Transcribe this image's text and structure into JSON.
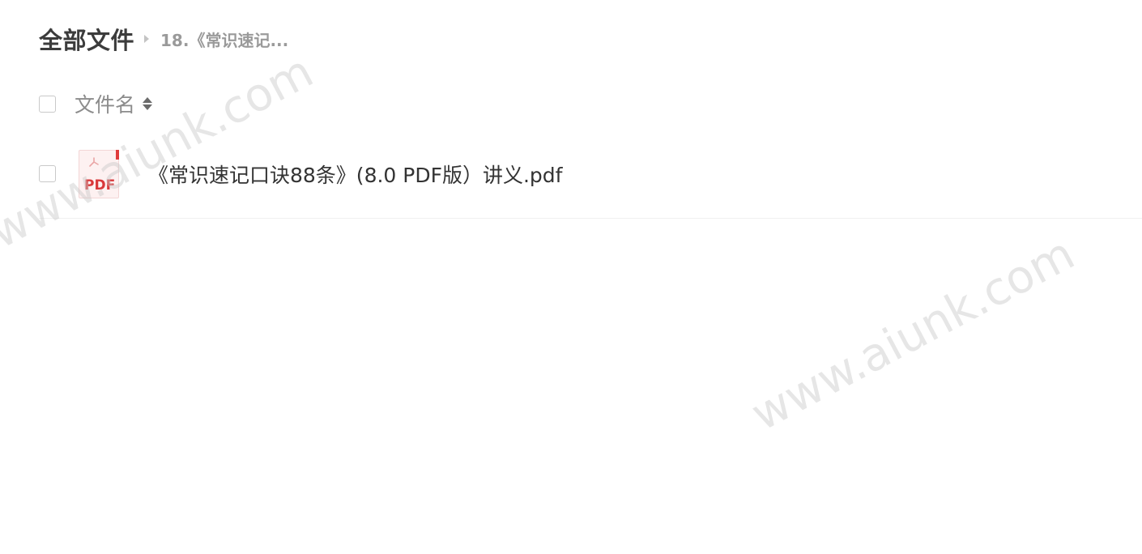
{
  "breadcrumb": {
    "root": "全部文件",
    "current": "18.《常识速记..."
  },
  "table": {
    "header": {
      "name_label": "文件名"
    },
    "rows": [
      {
        "name": "《常识速记口诀88条》(8.0 PDF版）讲义.pdf",
        "icon": "pdf-file-icon",
        "icon_label": "PDF"
      }
    ]
  },
  "watermark": {
    "text": "www.aiunk.com"
  },
  "colors": {
    "pdf_accent": "#d9383a",
    "text_primary": "#333333",
    "text_secondary": "#8c8c8c"
  }
}
